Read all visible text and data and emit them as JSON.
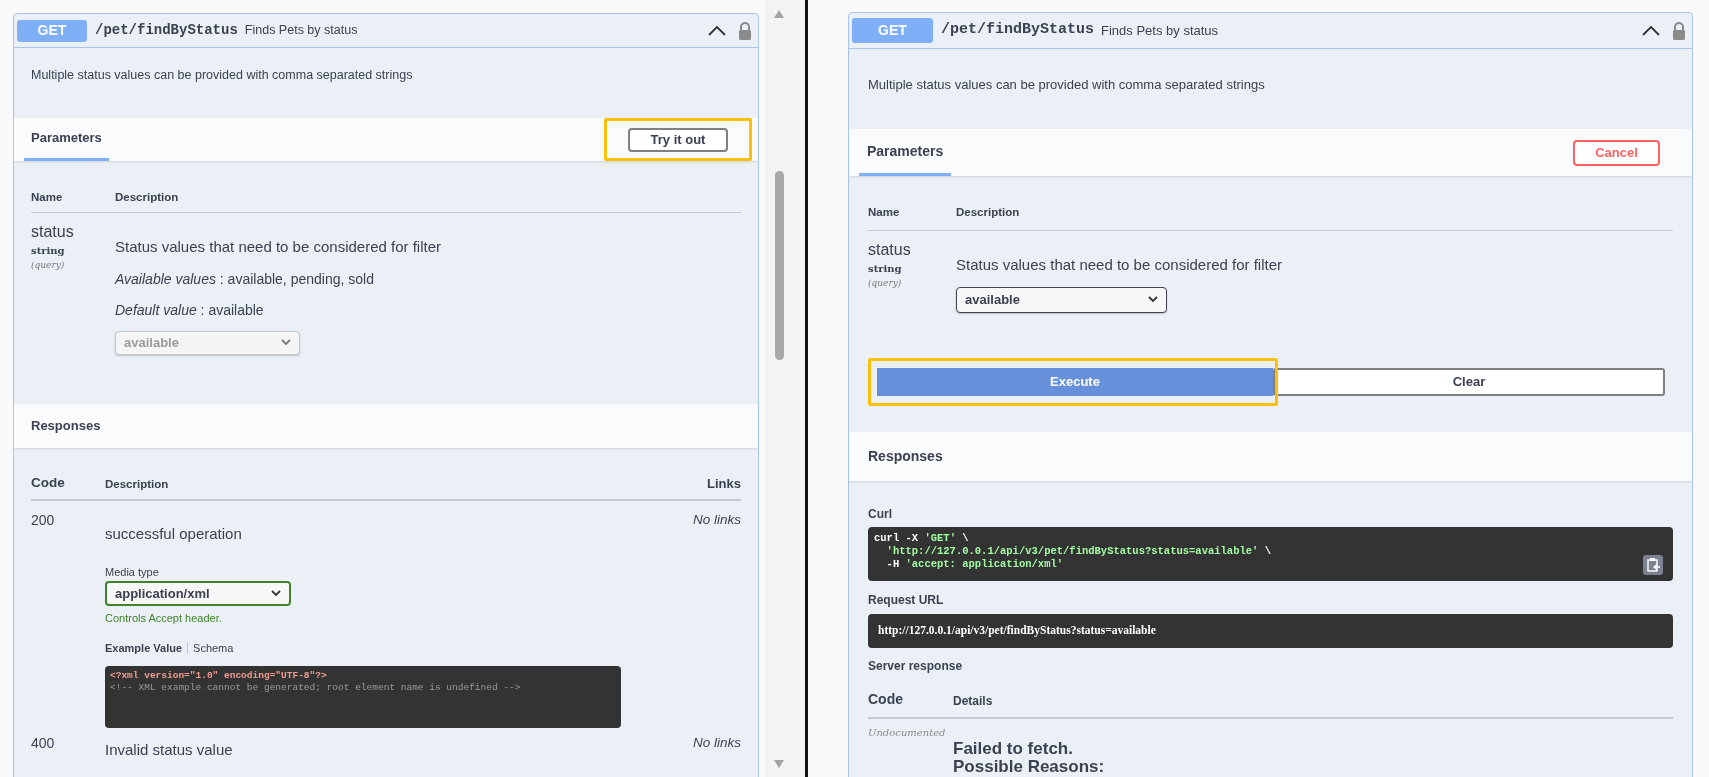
{
  "panels": [
    {
      "kind": "docs",
      "method": "GET",
      "path": "/pet/findByStatus",
      "summary": "Finds Pets by status",
      "expanded": true,
      "locked": true,
      "description": "Multiple status values can be provided with comma separated strings",
      "parameters_tab": {
        "label": "Parameters",
        "selected": true
      },
      "action_button": {
        "label": "Try it out",
        "kind": "try",
        "highlighted": true
      },
      "param_columns": [
        "Name",
        "Description"
      ],
      "parameter": {
        "name": "status",
        "type": "string",
        "location": "(query)",
        "description": "Status values that need to be considered for filter",
        "notes": [
          "*Available values* : available, pending, sold",
          "*Default value* : available"
        ],
        "select": {
          "value": "available",
          "disabled": true
        }
      },
      "responses_title": "Responses",
      "response_columns": [
        "Code",
        "Description",
        "Links"
      ],
      "responses": [
        {
          "code": "200",
          "description": "successful operation",
          "links": "No links",
          "media_type": {
            "label": "Media type",
            "value": "application/xml",
            "hint": "Controls Accept header."
          },
          "example_tabs": [
            {
              "label": "Example Value",
              "selected": true
            },
            {
              "label": "Schema",
              "selected": false
            }
          ],
          "example_lines": [
            {
              "kind": "declaration",
              "text": "<?xml version=\"1.0\" encoding=\"UTF-8\"?>"
            },
            {
              "kind": "comment",
              "text": "<!-- XML example cannot be generated; root element name is undefined -->"
            }
          ]
        },
        {
          "code": "400",
          "description": "Invalid status value",
          "links": "No links"
        }
      ]
    },
    {
      "kind": "try",
      "method": "GET",
      "path": "/pet/findByStatus",
      "summary": "Finds Pets by status",
      "expanded": true,
      "locked": true,
      "description": "Multiple status values can be provided with comma separated strings",
      "parameters_tab": {
        "label": "Parameters",
        "selected": true
      },
      "action_button": {
        "label": "Cancel",
        "kind": "cancel"
      },
      "param_columns": [
        "Name",
        "Description"
      ],
      "parameter": {
        "name": "status",
        "type": "string",
        "location": "(query)",
        "description": "Status values that need to be considered for filter",
        "select": {
          "value": "available",
          "disabled": false
        }
      },
      "execute_buttons": [
        {
          "label": "Execute",
          "kind": "primary",
          "highlighted": true
        },
        {
          "label": "Clear",
          "kind": "secondary",
          "highlighted": false
        }
      ],
      "responses_title": "Responses",
      "curl": {
        "label": "Curl",
        "lines": [
          {
            "segments": [
              {
                "kind": "plain",
                "text": "curl -X "
              },
              {
                "kind": "string",
                "text": "'GET'"
              },
              {
                "kind": "plain",
                "text": " \\"
              }
            ]
          },
          {
            "segments": [
              {
                "kind": "string",
                "text": "  'http://127.0.0.1/api/v3/pet/findByStatus?status=available'"
              },
              {
                "kind": "plain",
                "text": " \\"
              }
            ]
          },
          {
            "segments": [
              {
                "kind": "plain",
                "text": "  -H "
              },
              {
                "kind": "string",
                "text": "'accept: application/xml'"
              }
            ]
          }
        ]
      },
      "request_url": {
        "label": "Request URL",
        "value": "http://127.0.0.1/api/v3/pet/findByStatus?status=available"
      },
      "server_response": {
        "label": "Server response",
        "columns": [
          "Code",
          "Details"
        ],
        "code": "Undocumented",
        "details": [
          "Failed to fetch.",
          "Possible Reasons:"
        ]
      }
    }
  ]
}
